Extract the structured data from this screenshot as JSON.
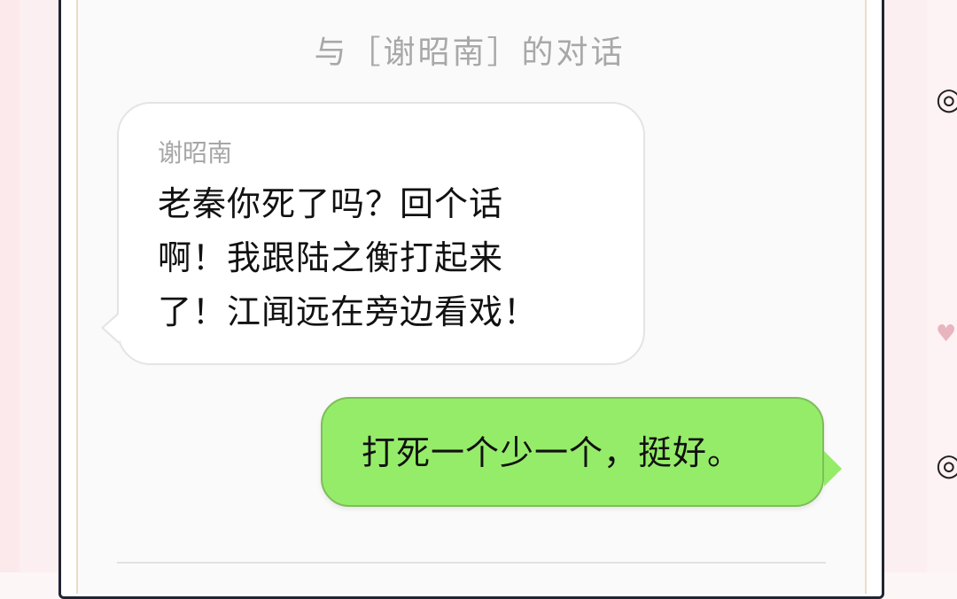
{
  "chat": {
    "title": "与［谢昭南］的对话",
    "messages": [
      {
        "side": "left",
        "sender": "谢昭南",
        "text": "老秦你死了吗？回个话\n啊！我跟陆之衡打起来\n了！江闻远在旁边看戏！"
      },
      {
        "side": "right",
        "text": "打死一个少一个，挺好。"
      }
    ]
  },
  "colors": {
    "incoming_bubble": "#ffffff",
    "outgoing_bubble": "#95ec69",
    "title_text": "#a8a8a8",
    "frame_border": "#1f2533"
  }
}
